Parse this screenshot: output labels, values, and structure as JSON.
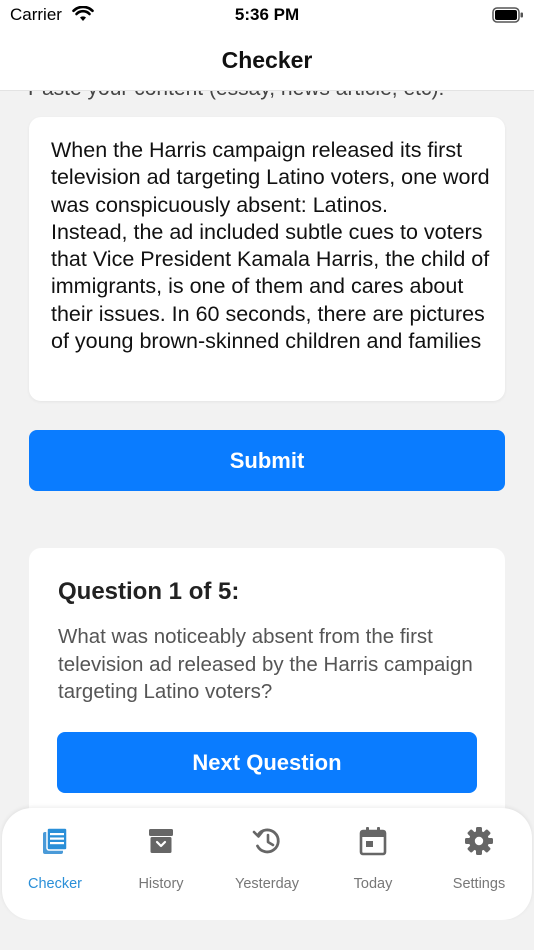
{
  "status_bar": {
    "carrier": "Carrier",
    "time": "5:36 PM"
  },
  "nav": {
    "title": "Checker"
  },
  "input_section": {
    "prompt_label": "Paste your content (essay, news article, etc):",
    "content_text": "When the Harris campaign released its first television ad targeting Latino voters, one word was conspicuously absent: Latinos.\nInstead, the ad included subtle cues to voters that Vice President Kamala Harris, the child of immigrants, is one of them and cares about their issues. In 60 seconds, there are pictures of young brown-skinned children and families",
    "submit_label": "Submit"
  },
  "question_section": {
    "title": "Question 1 of 5:",
    "question": "What was noticeably absent from the first television ad released by the Harris campaign targeting Latino voters?",
    "next_label": "Next Question"
  },
  "tab_bar": {
    "items": [
      {
        "label": "Checker",
        "icon": "newspaper-icon",
        "active": true
      },
      {
        "label": "History",
        "icon": "archive-box-icon",
        "active": false
      },
      {
        "label": "Yesterday",
        "icon": "clock-history-icon",
        "active": false
      },
      {
        "label": "Today",
        "icon": "calendar-icon",
        "active": false
      },
      {
        "label": "Settings",
        "icon": "gear-icon",
        "active": false
      }
    ]
  },
  "colors": {
    "accent": "#0a7cff",
    "active_tab": "#2a8fd8",
    "inactive_tab": "#777777",
    "background": "#f2f2f2"
  }
}
